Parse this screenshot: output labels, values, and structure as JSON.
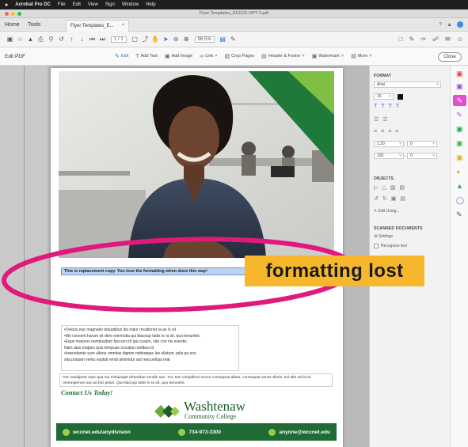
{
  "menubar": {
    "app_name": "Acrobat Pro DC",
    "items": [
      "File",
      "Edit",
      "View",
      "Sign",
      "Window",
      "Help"
    ]
  },
  "window": {
    "title": "Flyer Templates_013122-OPT-2.pdf"
  },
  "tabs": {
    "home": "Home",
    "tools": "Tools",
    "document": "Flyer Templates_E..."
  },
  "toolbar": {
    "page_current": "1",
    "page_total": "/ 1",
    "zoom": "96.5%"
  },
  "edit_bar": {
    "label": "Edit PDF",
    "tools": [
      {
        "icon": "edit-icon",
        "label": "Edit"
      },
      {
        "icon": "add-text-icon",
        "label": "Add Text"
      },
      {
        "icon": "add-image-icon",
        "label": "Add Image"
      },
      {
        "icon": "link-icon",
        "label": "Link"
      },
      {
        "icon": "crop-icon",
        "label": "Crop Pages"
      },
      {
        "icon": "header-footer-icon",
        "label": "Header & Footer"
      },
      {
        "icon": "watermark-icon",
        "label": "Watermark"
      },
      {
        "icon": "more-icon",
        "label": "More"
      }
    ],
    "close": "Close"
  },
  "document": {
    "replacement_line": "This is replacement copy. You lose the formatting when done this way!",
    "bullets": [
      "•Ovidus eiur magnatio doluptibus dis natur recationet ra as is sit",
      "•Mo consent harum sit dero ommodia qui blacoup tatiis is ra sit, quo beruntint.",
      "•Eque maioros oumtiusdam faccum int qui cusam, vita con nis eventis.",
      "  Nam atus magnis quis tempuse occulpa runtibus id",
      "•Invendunde sum ullene omnitas dignim nobitatque les ullatunt, ipila pa eos",
      "  sita pratiam veritu explati rendi aiminidur aut reat peliqui reat"
    ],
    "paragraph": "Ore sandipunt repe qua ina minipsapit rehendae vendit, sas. Tur, tem voluptibus exces consequat aliam, consequat venet ullorio. Ed alet vel id et ommniperum aut archici pition. Qui blacoup tatiis is ra sit, quo beruntint.",
    "contact_heading": "Contact Us Today!",
    "logo_name": "Washtenaw",
    "logo_sub": "Community College",
    "footer": {
      "web": "wccnet.edu/anydivision",
      "phone": "734-973-3300",
      "email": "anyone@wccnet.edu"
    }
  },
  "format_panel": {
    "heading": "FORMAT",
    "font": "Arial",
    "size": "15",
    "line_spacing": "1.20",
    "para_spacing": "0",
    "scale": "100",
    "char_spacing": "0",
    "objects_heading": "OBJECTS",
    "edit_using": "Edit Using...",
    "scanned_heading": "SCANNED DOCUMENTS",
    "settings": "Settings",
    "recognize": "Recognize text",
    "colors": {
      "text": "#111111"
    }
  },
  "annotation": {
    "callout": "formatting lost",
    "ellipse_color": "#e0197d",
    "callout_color": "#f6b72c"
  }
}
